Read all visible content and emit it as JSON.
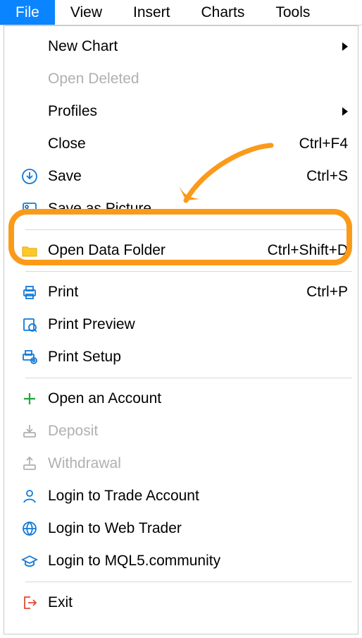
{
  "menubar": {
    "items": [
      {
        "label": "File",
        "active": true
      },
      {
        "label": "View",
        "active": false
      },
      {
        "label": "Insert",
        "active": false
      },
      {
        "label": "Charts",
        "active": false
      },
      {
        "label": "Tools",
        "active": false
      }
    ]
  },
  "menu": {
    "new_chart": {
      "label": "New Chart"
    },
    "open_deleted": {
      "label": "Open Deleted"
    },
    "profiles": {
      "label": "Profiles"
    },
    "close": {
      "label": "Close",
      "shortcut": "Ctrl+F4"
    },
    "save": {
      "label": "Save",
      "shortcut": "Ctrl+S"
    },
    "save_picture": {
      "label": "Save as Picture"
    },
    "open_data_folder": {
      "label": "Open Data Folder",
      "shortcut": "Ctrl+Shift+D"
    },
    "print": {
      "label": "Print",
      "shortcut": "Ctrl+P"
    },
    "print_preview": {
      "label": "Print Preview"
    },
    "print_setup": {
      "label": "Print Setup"
    },
    "open_account": {
      "label": "Open an Account"
    },
    "deposit": {
      "label": "Deposit"
    },
    "withdrawal": {
      "label": "Withdrawal"
    },
    "login_trade": {
      "label": "Login to Trade Account"
    },
    "login_web": {
      "label": "Login to Web Trader"
    },
    "login_mql5": {
      "label": "Login to MQL5.community"
    },
    "exit": {
      "label": "Exit"
    }
  },
  "annotation": {
    "highlight_color": "#fb9a19"
  }
}
